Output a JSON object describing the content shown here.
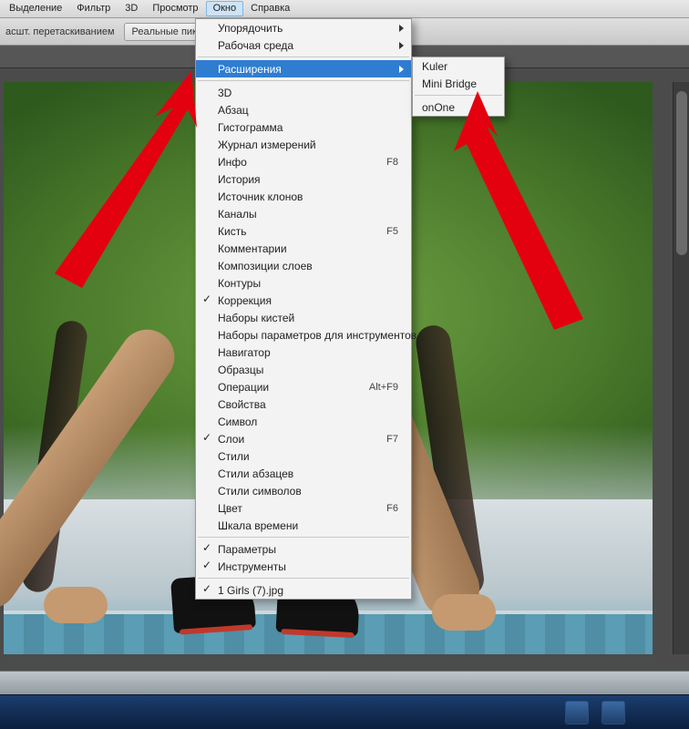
{
  "menubar": {
    "items": [
      "Выделение",
      "Фильтр",
      "3D",
      "Просмотр",
      "Окно",
      "Справка"
    ],
    "active_index": 4
  },
  "optionsbar": {
    "drag_label": "асшт. перетаскиванием",
    "real_pixels_label": "Реальные пикселы"
  },
  "window_menu": {
    "top": [
      {
        "label": "Упорядочить",
        "submenu": true
      },
      {
        "label": "Рабочая среда",
        "submenu": true
      }
    ],
    "extensions": {
      "label": "Расширения",
      "submenu": true
    },
    "middle": [
      {
        "label": "3D"
      },
      {
        "label": "Абзац"
      },
      {
        "label": "Гистограмма"
      },
      {
        "label": "Журнал измерений"
      },
      {
        "label": "Инфо",
        "shortcut": "F8"
      },
      {
        "label": "История"
      },
      {
        "label": "Источник клонов"
      },
      {
        "label": "Каналы"
      },
      {
        "label": "Кисть",
        "shortcut": "F5"
      },
      {
        "label": "Комментарии"
      },
      {
        "label": "Композиции слоев"
      },
      {
        "label": "Контуры"
      },
      {
        "label": "Коррекция",
        "checked": true
      },
      {
        "label": "Наборы кистей"
      },
      {
        "label": "Наборы параметров для инструментов"
      },
      {
        "label": "Навигатор"
      },
      {
        "label": "Образцы"
      },
      {
        "label": "Операции",
        "shortcut": "Alt+F9"
      },
      {
        "label": "Свойства"
      },
      {
        "label": "Символ"
      },
      {
        "label": "Слои",
        "shortcut": "F7",
        "checked": true
      },
      {
        "label": "Стили"
      },
      {
        "label": "Стили абзацев"
      },
      {
        "label": "Стили символов"
      },
      {
        "label": "Цвет",
        "shortcut": "F6"
      },
      {
        "label": "Шкала времени"
      }
    ],
    "bottom1": [
      {
        "label": "Параметры",
        "checked": true
      },
      {
        "label": "Инструменты",
        "checked": true
      }
    ],
    "bottom2": [
      {
        "label": "1 Girls (7).jpg",
        "checked": true
      }
    ]
  },
  "extensions_submenu": {
    "group1": [
      "Kuler",
      "Mini Bridge"
    ],
    "group2": [
      "onOne"
    ]
  }
}
